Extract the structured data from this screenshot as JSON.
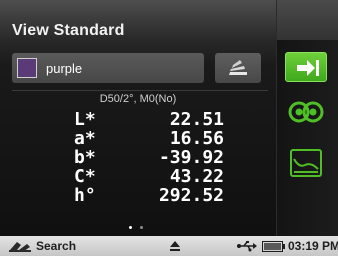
{
  "header": {
    "title": "View Standard"
  },
  "sample": {
    "name": "purple",
    "swatch_color": "#5b3a78"
  },
  "illuminant": "D50/2°, M0(No)",
  "readings": [
    {
      "label": "L*",
      "value": "22.51"
    },
    {
      "label": "a*",
      "value": "16.56"
    },
    {
      "label": "b*",
      "value": "-39.92"
    },
    {
      "label": "C*",
      "value": "43.22"
    },
    {
      "label": "h°",
      "value": "292.52"
    }
  ],
  "pager": {
    "pages": 2,
    "active": 1
  },
  "side_buttons": [
    {
      "icon": "arrow-right-bar-icon",
      "accent": "#4fbf26"
    },
    {
      "icon": "compare-circles-icon",
      "accent": "#4fbf26"
    },
    {
      "icon": "spectral-graph-icon",
      "accent": "#4fbf26"
    }
  ],
  "status_bar": {
    "search_label": "Search",
    "time": "03:19 PM"
  }
}
